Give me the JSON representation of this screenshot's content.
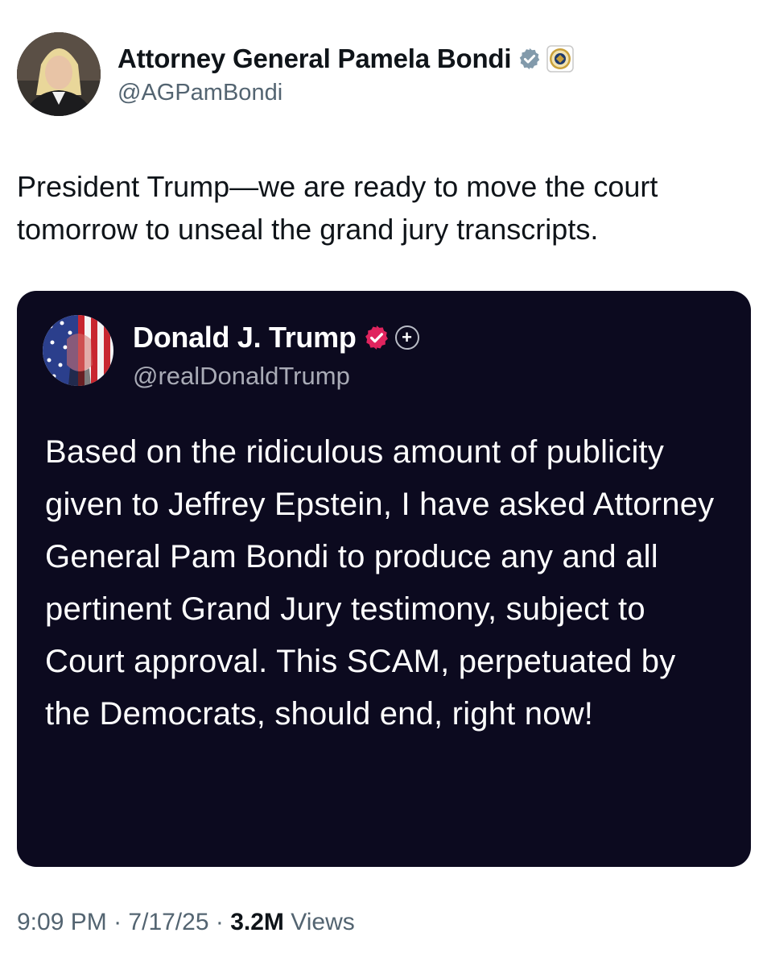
{
  "author": {
    "display_name": "Attorney General Pamela Bondi",
    "handle": "@AGPamBondi",
    "verified_badge_icon": "verified-badge-grey-icon",
    "affiliation_icon": "doj-seal-icon",
    "badge_color": "#829aab"
  },
  "tweet": {
    "text": "President Trump—we are ready to move the court tomorrow to unseal the grand jury transcripts."
  },
  "quoted_post": {
    "display_name": "Donald J. Trump",
    "handle": "@realDonaldTrump",
    "verified_badge_icon": "verified-badge-red-icon",
    "plus_icon": "plus-circle-icon",
    "badge_color": "#e0245e",
    "background_color": "#0c0a1f",
    "text": "Based on the ridiculous amount of publicity given to Jeffrey Epstein, I have asked Attorney General Pam Bondi to produce any and all pertinent Grand Jury testimony, subject to Court approval. This SCAM, perpetuated by the Democrats, should end, right now!"
  },
  "meta": {
    "time": "9:09 PM",
    "separator": "·",
    "date": "7/17/25",
    "views_count": "3.2M",
    "views_label": "Views"
  }
}
